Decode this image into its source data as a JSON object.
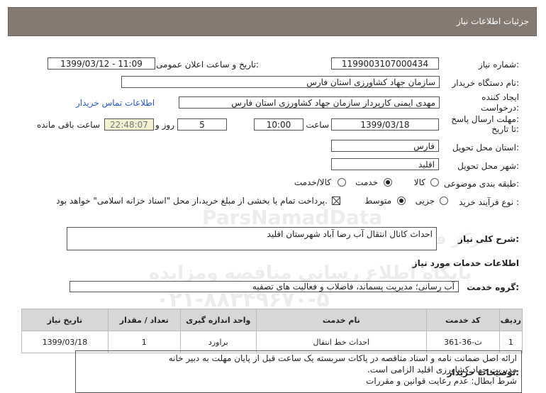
{
  "header": {
    "title": "جزئیات اطلاعات نیاز"
  },
  "form": {
    "need_number": {
      "label": "شماره نیاز:",
      "value": "1199003107000434"
    },
    "announce": {
      "label": "تاریخ و ساعت اعلان عمومی:",
      "value": "1399/03/12 - 11:09"
    },
    "buyer_org": {
      "label": "نام دستگاه خریدار:",
      "value": "سازمان جهاد کشاورزی استان فارس"
    },
    "creator": {
      "label_line1": "ایجاد کننده",
      "label_line2": "درخواست:",
      "value": "مهدی ایمنی کارپرداز سازمان جهاد کشاورزی استان فارس",
      "contact_link": "اطلاعات تماس خریدار"
    },
    "deadline": {
      "label_line1": "مهلت ارسال پاسخ:",
      "label_line2": "تا تاریخ:",
      "date": "1399/03/18",
      "time_label": "ساعت",
      "time": "10:00",
      "days": "5",
      "days_label": "روز و",
      "remaining": "22:48:07",
      "remaining_label": "ساعت باقی مانده"
    },
    "province": {
      "label": "استان محل تحویل:",
      "value": "فارس"
    },
    "city": {
      "label": "شهر محل تحویل:",
      "value": "اقلید"
    },
    "category": {
      "label": "طبقه بندی موضوعی:",
      "options": [
        "کالا",
        "خدمت",
        "کالا/خدمت"
      ],
      "selected": "خدمت"
    },
    "process": {
      "label": "نوع فرآیند خرید :",
      "options": [
        "جزیی",
        "متوسط"
      ],
      "selected": "متوسط",
      "payment_note": "پرداخت تمام یا بخشی از مبلغ خرید،از محل \"اسناد خزانه اسلامی\" خواهد بود."
    }
  },
  "summary": {
    "label": "شرح کلی نیاز:",
    "value": "احداث کانال انتقال آب رضا آباد شهرستان اقلید"
  },
  "services_section": {
    "title": "اطلاعات خدمات مورد نیاز"
  },
  "service_group": {
    "label": "گروه خدمت:",
    "value": "آب رسانی؛ مدیریت پسماند، فاضلاب و فعالیت های تصفیه"
  },
  "table": {
    "headers": [
      "ردیف",
      "کد خدمت",
      "نام خدمت",
      "واحد اندازه گیری",
      "تعداد / مقدار",
      "تاریخ نیاز"
    ],
    "rows": [
      [
        "1",
        "ث-36-361",
        "احداث خط انتقال",
        "براورد",
        "1",
        "1399/03/18"
      ]
    ]
  },
  "buyer_notes": {
    "label": "توضیحات خریدار:",
    "lines": [
      "ارائه اصل ضمانت نامه و اسناد مناقصه  در پاکات سربسته یک ساعت قبل از پایان مهلت به دبیر خانه",
      "مدیریت جهاد کشاورزی اقلید الزامی است.",
      "شرط ابطال: عدم  رعایت قوانین و مقررات"
    ]
  },
  "watermark": {
    "brand": "ParsNamadData",
    "line1": "مرکز فراوری اطلاعات پارس نماد داده ها",
    "line2": "پایگاه اطلاع رسانی مناقصه ومزایده",
    "line3": "۰۲۱-۸۸۳۴۹۶۷۰-۵"
  }
}
